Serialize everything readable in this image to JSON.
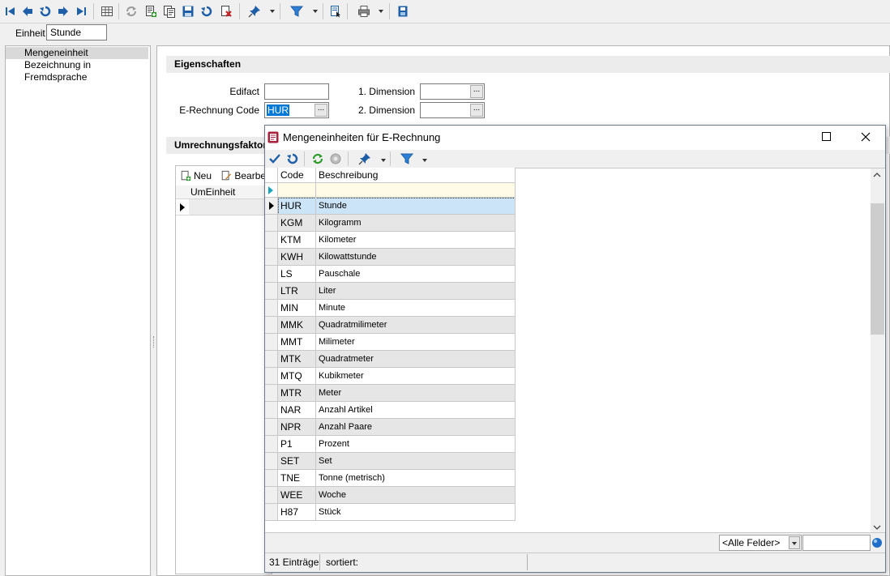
{
  "window": {
    "einheit_label": "Einheit",
    "einheit_value": "Stunde"
  },
  "toolbar": {
    "icons": [
      "first-record-icon",
      "previous-record-icon",
      "undo-icon",
      "next-record-icon",
      "last-record-icon",
      "table-view-icon",
      "refresh-icon",
      "new-record-icon",
      "copy-record-icon",
      "save-icon",
      "undo-changes-icon",
      "delete-icon",
      "pin-icon",
      "filter-icon",
      "document-icon",
      "print-icon",
      "export-icon"
    ]
  },
  "tree": {
    "items": [
      "Mengeneinheit",
      "Bezeichnung in Fremdsprache"
    ],
    "selected_index": 0
  },
  "eigenschaften": {
    "title": "Eigenschaften",
    "edifact_label": "Edifact",
    "edifact_value": "",
    "erechnung_label": "E-Rechnung Code",
    "erechnung_value": "HUR",
    "dim1_label": "1. Dimension",
    "dim1_value": "",
    "dim2_label": "2. Dimension",
    "dim2_value": "",
    "ellipsis": "..."
  },
  "umrechnung": {
    "title": "Umrechnungsfaktore",
    "new_label": "Neu",
    "edit_label": "Bearbe",
    "column_header": "UmEinheit"
  },
  "dialog": {
    "title": "Mengeneinheiten für E-Rechnung",
    "columns": [
      "Code",
      "Beschreibung"
    ],
    "rows": [
      {
        "code": "HUR",
        "desc": "Stunde"
      },
      {
        "code": "KGM",
        "desc": "Kilogramm"
      },
      {
        "code": "KTM",
        "desc": "Kilometer"
      },
      {
        "code": "KWH",
        "desc": "Kilowattstunde"
      },
      {
        "code": "LS",
        "desc": "Pauschale"
      },
      {
        "code": "LTR",
        "desc": "Liter"
      },
      {
        "code": "MIN",
        "desc": "Minute"
      },
      {
        "code": "MMK",
        "desc": "Quadratmilimeter"
      },
      {
        "code": "MMT",
        "desc": "Milimeter"
      },
      {
        "code": "MTK",
        "desc": "Quadratmeter"
      },
      {
        "code": "MTQ",
        "desc": "Kubikmeter"
      },
      {
        "code": "MTR",
        "desc": "Meter"
      },
      {
        "code": "NAR",
        "desc": "Anzahl Artikel"
      },
      {
        "code": "NPR",
        "desc": "Anzahl Paare"
      },
      {
        "code": "P1",
        "desc": "Prozent"
      },
      {
        "code": "SET",
        "desc": "Set"
      },
      {
        "code": "TNE",
        "desc": "Tonne (metrisch)"
      },
      {
        "code": "WEE",
        "desc": "Woche"
      },
      {
        "code": "H87",
        "desc": "Stück"
      }
    ],
    "selected_index": 0,
    "filter_select": "<Alle Felder>",
    "filter_value": "",
    "status_count": "31 Einträge",
    "status_sort": "sortiert:"
  },
  "colors": {
    "accent": "#0078d7",
    "selected_row": "#cce4f7",
    "alt_row": "#e6e6e6",
    "icon_blue": "#1f5fa8",
    "icon_green": "#2e9b2e",
    "icon_red": "#c82020"
  }
}
